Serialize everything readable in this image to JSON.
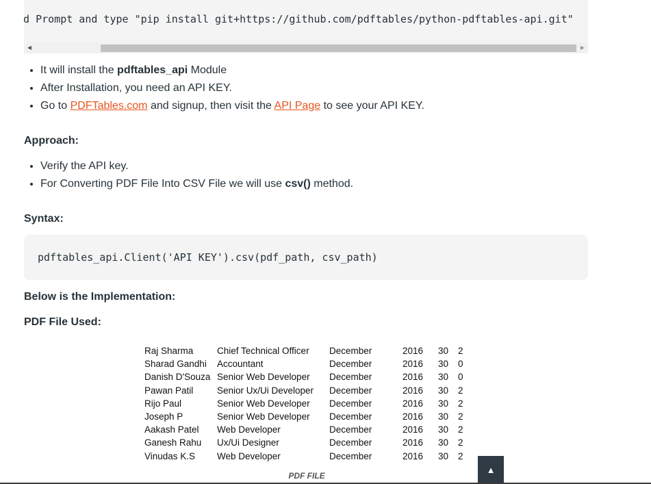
{
  "code_top": {
    "text": "nd Prompt and type \"pip install git+https://github.com/pdftables/python-pdftables-api.git\"",
    "scroll_left_icon": "triangle-left-icon",
    "scroll_right_icon": "triangle-right-icon"
  },
  "list1": {
    "item1_pre": "It will install the ",
    "item1_bold": "pdftables_api",
    "item1_post": " Module",
    "item2": "After Installation, you need an API KEY.",
    "item3_pre": "Go to ",
    "item3_link1": "PDFTables.com",
    "item3_mid": " and signup, then visit the ",
    "item3_link2": "API Page",
    "item3_post": " to see your API KEY."
  },
  "approach": {
    "heading": "Approach:",
    "item1": "Verify the API key.",
    "item2_pre": "For Converting PDF File Into CSV File we will use ",
    "item2_bold": "csv()",
    "item2_post": " method."
  },
  "syntax": {
    "heading": "Syntax:",
    "code": "pdftables_api.Client('API KEY').csv(pdf_path, csv_path)"
  },
  "implementation_heading": "Below is the Implementation:",
  "pdf_heading": "PDF File Used:",
  "pdf_rows": [
    {
      "name": "Raj Sharma",
      "role": "Chief Technical Officer",
      "month": "December",
      "year": "2016",
      "day": "30",
      "n": "2"
    },
    {
      "name": "Sharad Gandhi",
      "role": "Accountant",
      "month": "December",
      "year": "2016",
      "day": "30",
      "n": "0"
    },
    {
      "name": "Danish D'Souza",
      "role": "Senior Web Developer",
      "month": "December",
      "year": "2016",
      "day": "30",
      "n": "0"
    },
    {
      "name": "Pawan Patil",
      "role": "Senior Ux/Ui Developer",
      "month": "December",
      "year": "2016",
      "day": "30",
      "n": "2"
    },
    {
      "name": "Rijo Paul",
      "role": "Senior Web Developer",
      "month": "December",
      "year": "2016",
      "day": "30",
      "n": "2"
    },
    {
      "name": "Joseph P",
      "role": "Senior Web Developer",
      "month": "December",
      "year": "2016",
      "day": "30",
      "n": "2"
    },
    {
      "name": "Aakash Patel",
      "role": "Web Developer",
      "month": "December",
      "year": "2016",
      "day": "30",
      "n": "2"
    },
    {
      "name": "Ganesh Rahu",
      "role": "Ux/Ui Designer",
      "month": "December",
      "year": "2016",
      "day": "30",
      "n": "2"
    },
    {
      "name": "Vinudas K.S",
      "role": "Web Developer",
      "month": "December",
      "year": "2016",
      "day": "30",
      "n": "2"
    }
  ],
  "caption": "PDF FILE",
  "back_to_top": {
    "icon": "triangle-up-icon",
    "glyph": "▲"
  },
  "colors": {
    "link": "#e8541e",
    "text": "#273239",
    "code_bg": "#f4f4f4",
    "back_to_top_bg": "#2f3a44"
  }
}
